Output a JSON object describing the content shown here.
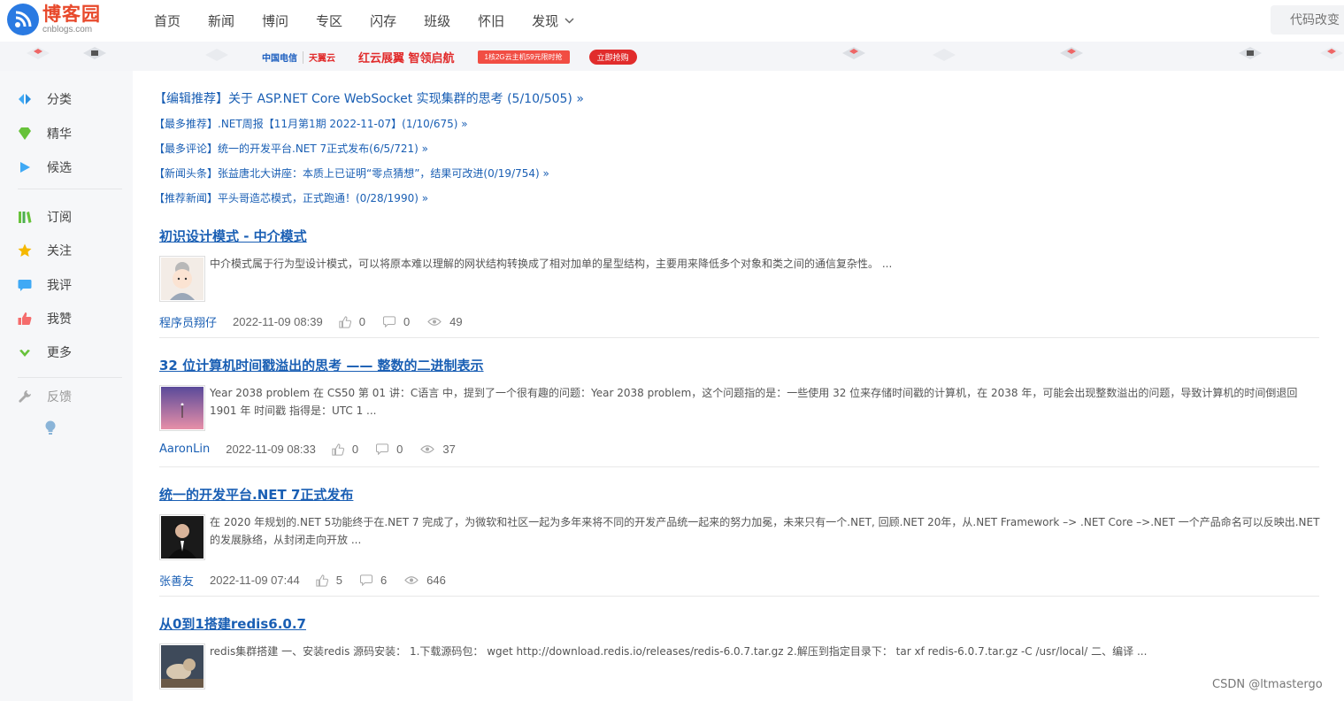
{
  "header": {
    "logo_cn": "博客园",
    "logo_en": "cnblogs.com",
    "nav": [
      "首页",
      "新闻",
      "博问",
      "专区",
      "闪存",
      "班级",
      "怀旧",
      "发现"
    ],
    "search_placeholder": "代码改变"
  },
  "banner": {
    "brand1": "中国电信",
    "brand2": "天翼云",
    "slogan": "红云展翼 智领启航",
    "promo": "1核2G云主机59元限时抢",
    "button": "立即抢购"
  },
  "sidebar": {
    "items": [
      {
        "label": "分类",
        "icon": "category-icon"
      },
      {
        "label": "精华",
        "icon": "gem-icon"
      },
      {
        "label": "候选",
        "icon": "play-icon"
      },
      {
        "label": "订阅",
        "icon": "books-icon"
      },
      {
        "label": "关注",
        "icon": "star-icon"
      },
      {
        "label": "我评",
        "icon": "comment-icon"
      },
      {
        "label": "我赞",
        "icon": "thumbs-up-icon"
      },
      {
        "label": "更多",
        "icon": "check-icon"
      },
      {
        "label": "反馈",
        "icon": "wrench-icon"
      }
    ],
    "bulb_icon": "lightbulb-icon"
  },
  "picks": [
    "【编辑推荐】关于 ASP.NET Core WebSocket 实现集群的思考 (5/10/505) »",
    "【最多推荐】.NET周报【11月第1期 2022-11-07】(1/10/675) »",
    "【最多评论】统一的开发平台.NET 7正式发布(6/5/721) »",
    "【新闻头条】张益唐北大讲座：本质上已证明“零点猜想”，结果可改进(0/19/754) »",
    "【推荐新闻】平头哥造芯模式，正式跑通！(0/28/1990) »"
  ],
  "posts": [
    {
      "title": "初识设计模式 - 中介模式",
      "summary": "中介模式属于行为型设计模式，可以将原本难以理解的网状结构转换成了相对加单的星型结构，主要用来降低多个对象和类之间的通信复杂性。 ...",
      "author": "程序员翔仔",
      "date": "2022-11-09 08:39",
      "likes": "0",
      "comments": "0",
      "views": "49"
    },
    {
      "title": "32 位计算机时间戳溢出的思考 —— 整数的二进制表示",
      "summary": "Year 2038 problem 在 CS50 第 01 讲：C语言 中，提到了一个很有趣的问题：Year 2038 problem，这个问题指的是：一些使用 32 位来存储时间戳的计算机，在 2038 年，可能会出现整数溢出的问题，导致计算机的时间倒退回 1901 年 时间戳 指得是：UTC 1 ...",
      "author": "AaronLin",
      "date": "2022-11-09 08:33",
      "likes": "0",
      "comments": "0",
      "views": "37"
    },
    {
      "title": "统一的开发平台.NET 7正式发布",
      "summary": "在 2020 年规划的.NET 5功能终于在.NET 7 完成了，为微软和社区一起为多年来将不同的开发产品统一起来的努力加冕，未来只有一个.NET, 回顾.NET 20年，从.NET Framework –> .NET Core –>.NET 一个产品命名可以反映出.NET的发展脉络，从封闭走向开放 ...",
      "author": "张善友",
      "date": "2022-11-09 07:44",
      "likes": "5",
      "comments": "6",
      "views": "646"
    },
    {
      "title": "从0到1搭建redis6.0.7",
      "summary": "redis集群搭建 一、安装redis 源码安装： 1.下载源码包： wget http://download.redis.io/releases/redis-6.0.7.tar.gz 2.解压到指定目录下： tar xf redis-6.0.7.tar.gz -C /usr/local/ 二、编译 ..."
    }
  ],
  "watermark": "CSDN @ltmastergo",
  "colors": {
    "link": "#1a5fb4",
    "logo_red": "#e8492b",
    "logo_blue": "#2a7ae2"
  }
}
